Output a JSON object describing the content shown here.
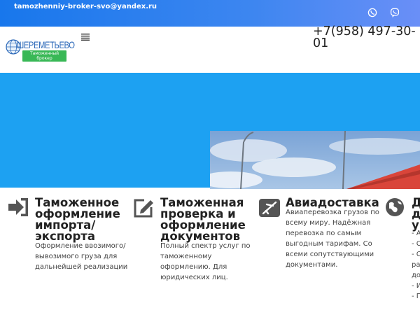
{
  "topbar": {
    "email": "tamozhenniy-broker-svo@yandex.ru",
    "icons": [
      "whatsapp-icon",
      "viber-icon"
    ]
  },
  "header": {
    "logo_title": "ШЕРЕМЕТЬЕВО",
    "logo_badge_line1": "Таможенный",
    "logo_badge_line2": "брокер",
    "menu_icon": "menu-icon",
    "phone": "+7(958) 497-30-01"
  },
  "colors": {
    "topbar_start": "#1877ec",
    "topbar_end": "#6a8ff7",
    "hero": "#1da1f2",
    "logo_badge": "#39b856",
    "icon_dark": "#555555"
  },
  "features": [
    {
      "icon": "sign-in-icon",
      "title": [
        "Таможенное",
        "оформление",
        "импорта/",
        "экспорта"
      ],
      "text": [
        "Оформление ввозимого/",
        "вывозимого груза для",
        "дальнейшей реализации"
      ]
    },
    {
      "icon": "edit-icon",
      "title": [
        "Таможенная",
        "проверка и",
        "оформление",
        "документов"
      ],
      "text": [
        "Полный спектр услуг по",
        "таможенному",
        "оформлению. Для",
        "юридических лиц."
      ]
    },
    {
      "icon": "plane-icon",
      "title": [
        "Авиадоставка"
      ],
      "text": [
        "Авиаперевозка грузов по",
        "всему миру. Надёжная",
        "перевозка по самым",
        "выгодным тарифам. Со",
        "всеми сопутствующими",
        "документами."
      ]
    },
    {
      "icon": "globe-icon",
      "title": [
        "Д",
        "д",
        "у"
      ],
      "text": [
        "- А",
        "- С",
        "- С",
        "ра",
        "до",
        "- И",
        "- П"
      ]
    }
  ]
}
